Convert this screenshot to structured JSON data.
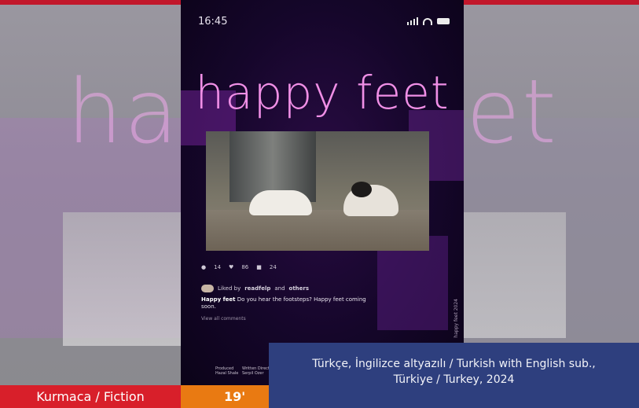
{
  "background": {
    "large_title": "happy feet",
    "colors": {
      "top_strip": "#c2172b",
      "backdrop": "#8e8b95"
    }
  },
  "poster": {
    "status_time": "16:45",
    "title": "happy feet",
    "stats": [
      "14",
      "86",
      "24"
    ],
    "liked_prefix": "Liked by",
    "liked_user": "readfelp",
    "liked_and": "and",
    "liked_others": "others",
    "caption_user": "Happy feet",
    "caption_text": "Do you hear the footsteps? Happy feet coming soon.",
    "comments_link": "View all comments",
    "credits_left": [
      "Produced",
      "Hazal Shale"
    ],
    "credits_right": [
      "Written Directed",
      "Serpil Ozer"
    ],
    "vertical_text": "happy feet 2024"
  },
  "info": {
    "line1": "Türkçe, İngilizce altyazılı / Turkish with English sub.,",
    "line2": "Türkiye / Turkey, 2024"
  },
  "badges": {
    "genre": "Kurmaca / Fiction",
    "duration": "19'",
    "colors": {
      "genre": "#d81f2a",
      "duration": "#e97a12",
      "info": "#2e3f7e"
    }
  }
}
